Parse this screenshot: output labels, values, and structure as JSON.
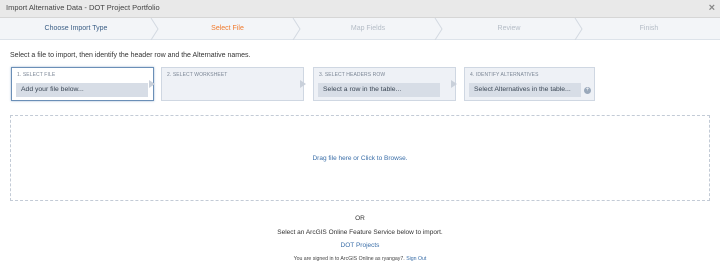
{
  "window": {
    "title": "Import Alternative Data - DOT Project Portfolio",
    "close_glyph": "×"
  },
  "wizard": {
    "steps": [
      {
        "label": "Choose Import Type",
        "state": "done"
      },
      {
        "label": "Select File",
        "state": "active"
      },
      {
        "label": "Map Fields",
        "state": "upcoming"
      },
      {
        "label": "Review",
        "state": "upcoming"
      },
      {
        "label": "Finish",
        "state": "upcoming"
      }
    ],
    "colors": {
      "done": "#3c5f86",
      "active": "#f07a2d",
      "upcoming": "#b4bcc6"
    }
  },
  "instruction": "Select a file to import, then identify the header row and the Alternative names.",
  "panels": [
    {
      "label": "1. SELECT FILE",
      "field": "Add your file below..."
    },
    {
      "label": "2. SELECT WORKSHEET",
      "field": ""
    },
    {
      "label": "3. SELECT HEADERS ROW",
      "field": "Select a row in the table..."
    },
    {
      "label": "4. IDENTIFY ALTERNATIVES",
      "field": "Select Alternatives in the table..."
    }
  ],
  "dropzone": {
    "text": "Drag file here or Click to Browse."
  },
  "or_text": "OR",
  "online_text": "Select an ArcGIS Online Feature Service below to import.",
  "projects_link": "DOT Projects",
  "signed_in": {
    "prefix": "You are signed in to ArcGIS Online as ryangay7.",
    "signout": "Sign Out"
  },
  "icons": {
    "close": "close-icon",
    "arrow": "chevron-right-icon",
    "add": "plus-circle-icon"
  }
}
